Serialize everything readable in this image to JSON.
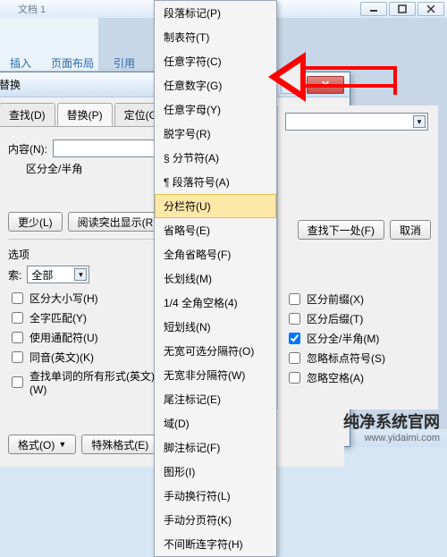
{
  "window": {
    "doc_label": "文档 1"
  },
  "ribbon": {
    "insert": "插入",
    "layout": "页面布局",
    "ref": "引用"
  },
  "dialog": {
    "title_tab": "替换",
    "tabs": {
      "find": "查找(D)",
      "replace": "替换(P)",
      "goto": "定位(G)"
    },
    "find_label": "内容(N):",
    "options_line": "区分全/半角",
    "btn_less": "更少(L)",
    "btn_highlight": "阅读突出显示(R)",
    "btn_findnext": "查找下一处(F)",
    "btn_cancel": "取消",
    "section": "选项",
    "search_label": "索:",
    "search_value": "全部",
    "cb_case": "区分大小写(H)",
    "cb_wholeword": "全字匹配(Y)",
    "cb_wildcard": "使用通配符(U)",
    "cb_soundslike": "同音(英文)(K)",
    "cb_allforms": "查找单词的所有形式(英文)(W)",
    "cb_prefix": "区分前缀(X)",
    "cb_suffix": "区分后缀(T)",
    "cb_fullhalf": "区分全/半角(M)",
    "cb_punct": "忽略标点符号(S)",
    "cb_space": "忽略空格(A)",
    "btn_format": "格式(O)",
    "btn_special": "特殊格式(E)"
  },
  "menu": {
    "items": [
      "段落标记(P)",
      "制表符(T)",
      "任意字符(C)",
      "任意数字(G)",
      "任意字母(Y)",
      "脱字号(R)",
      "§ 分节符(A)",
      "¶ 段落符号(A)",
      "分栏符(U)",
      "省略号(E)",
      "全角省略号(F)",
      "长划线(M)",
      "1/4 全角空格(4)",
      "短划线(N)",
      "无宽可选分隔符(O)",
      "无宽非分隔符(W)",
      "尾注标记(E)",
      "域(D)",
      "脚注标记(F)",
      "图形(I)",
      "手动换行符(L)",
      "手动分页符(K)",
      "不间断连字符(H)"
    ],
    "highlight_index": 8
  },
  "watermark": {
    "line1": "纯净系统官网",
    "line2": "www.yidaimi.com"
  }
}
